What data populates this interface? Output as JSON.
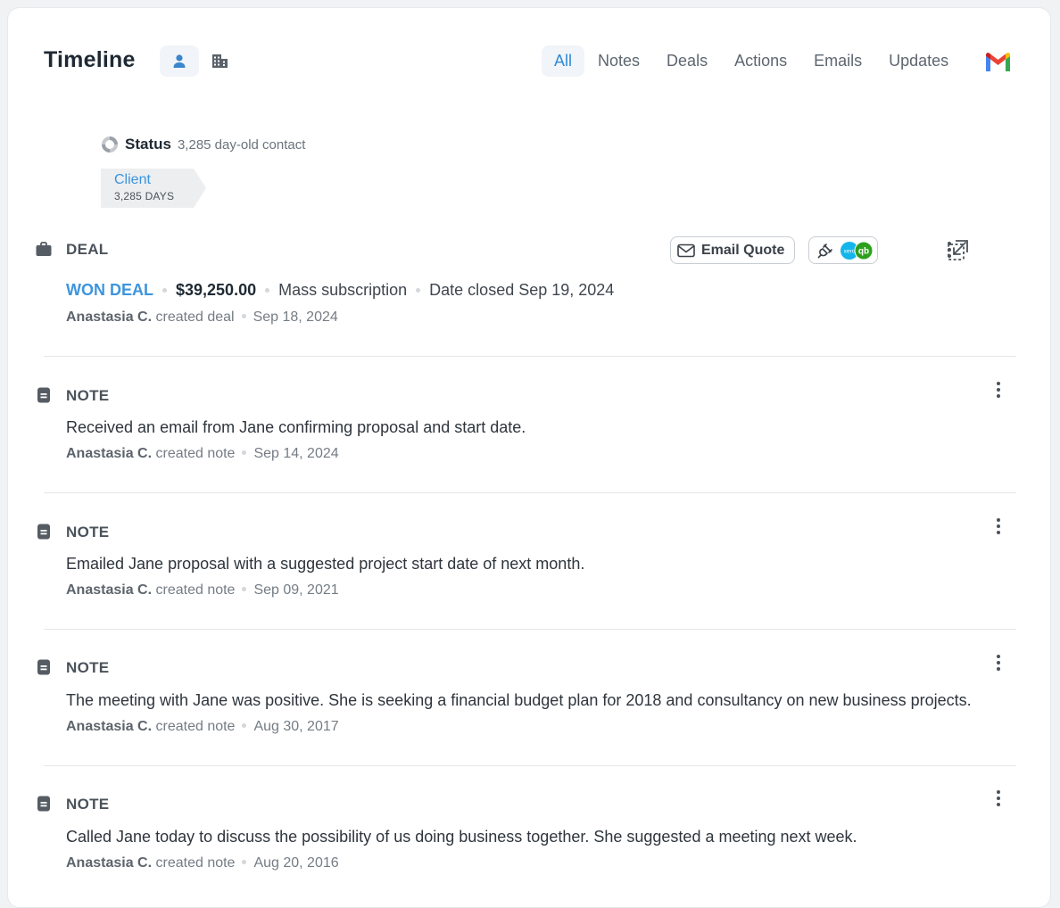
{
  "header": {
    "title": "Timeline",
    "tabs": [
      {
        "label": "All",
        "active": true
      },
      {
        "label": "Notes",
        "active": false
      },
      {
        "label": "Deals",
        "active": false
      },
      {
        "label": "Actions",
        "active": false
      },
      {
        "label": "Emails",
        "active": false
      },
      {
        "label": "Updates",
        "active": false
      }
    ],
    "icons": [
      "person-icon",
      "building-icon",
      "gmail-icon"
    ]
  },
  "status": {
    "label": "Status",
    "subtitle": "3,285 day-old contact",
    "stage_name": "Client",
    "stage_days": "3,285 DAYS"
  },
  "deal": {
    "type_label": "DEAL",
    "result": "WON DEAL",
    "amount": "$39,250.00",
    "name": "Mass subscription",
    "closed": "Date closed Sep 19, 2024",
    "author": "Anastasia C.",
    "action": "created deal",
    "date": "Sep 18, 2024",
    "email_quote_label": "Email Quote",
    "integration_badges": [
      "xero",
      "qb"
    ]
  },
  "notes": [
    {
      "type_label": "NOTE",
      "body": "Received an email from Jane confirming proposal and start date.",
      "author": "Anastasia C.",
      "action": "created note",
      "date": "Sep 14, 2024"
    },
    {
      "type_label": "NOTE",
      "body": "Emailed Jane proposal with a suggested project start date of next month.",
      "author": "Anastasia C.",
      "action": "created note",
      "date": "Sep 09, 2021"
    },
    {
      "type_label": "NOTE",
      "body": "The meeting with Jane was positive. She is seeking a financial budget plan for 2018 and consultancy on new business projects.",
      "author": "Anastasia C.",
      "action": "created note",
      "date": "Aug 30, 2017"
    },
    {
      "type_label": "NOTE",
      "body": "Called Jane today to discuss the possibility of us doing business together. She suggested a meeting next week.",
      "author": "Anastasia C.",
      "action": "created note",
      "date": "Aug 20, 2016"
    }
  ],
  "colors": {
    "accent": "#3e95dc",
    "title": "#1f2933",
    "divider": "#e4e6e9",
    "tab_active_bg": "#f1f4f8",
    "xero": "#13b5ea",
    "quickbooks": "#2ca01c"
  }
}
